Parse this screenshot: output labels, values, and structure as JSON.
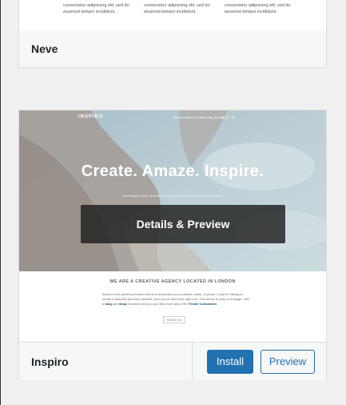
{
  "themes": [
    {
      "name": "Neve",
      "preview_features": [
        "consectetur adipiscing elit, sed do eiusmod tempor incididunt.",
        "consectetur adipiscing elit, sed do eiusmod tempor incididunt.",
        "consectetur adipiscing elit, sed do eiusmod tempor incididunt."
      ]
    },
    {
      "name": "Inspiro",
      "overlay_label": "Details & Preview",
      "install_label": "Install",
      "preview_label": "Preview",
      "preview": {
        "brand": "INSPIRO",
        "nav": "Home   Gallery   Portfolio   Blog   Shop   ▮   ◎   ○   ⊕",
        "hero_title": "Create. Amaze. Inspire.",
        "hero_sub": "Lorem ipsum dolor sit amet, consectetur adipiscing elit, sed do eiusmod",
        "agency_heading": "WE ARE A CREATIVE AGENCY LOCATED IN LONDON",
        "agency_text": "Inspiro is the perfect premium theme to showcase your portfolio, video, or photo. If you're looking to create a beautiful premium website, then you've found the right one. This theme is easy to manage, with a",
        "agency_link1": "blog",
        "agency_mid": "and",
        "agency_link2": "shop",
        "agency_tail": "included and you can read more about the",
        "agency_link3": "Theme Customizer",
        "know_more": "KNOW US"
      }
    }
  ],
  "colors": {
    "accent": "#2271b1",
    "card_border": "#dcdcde",
    "page_bg": "#f0f0f1"
  }
}
